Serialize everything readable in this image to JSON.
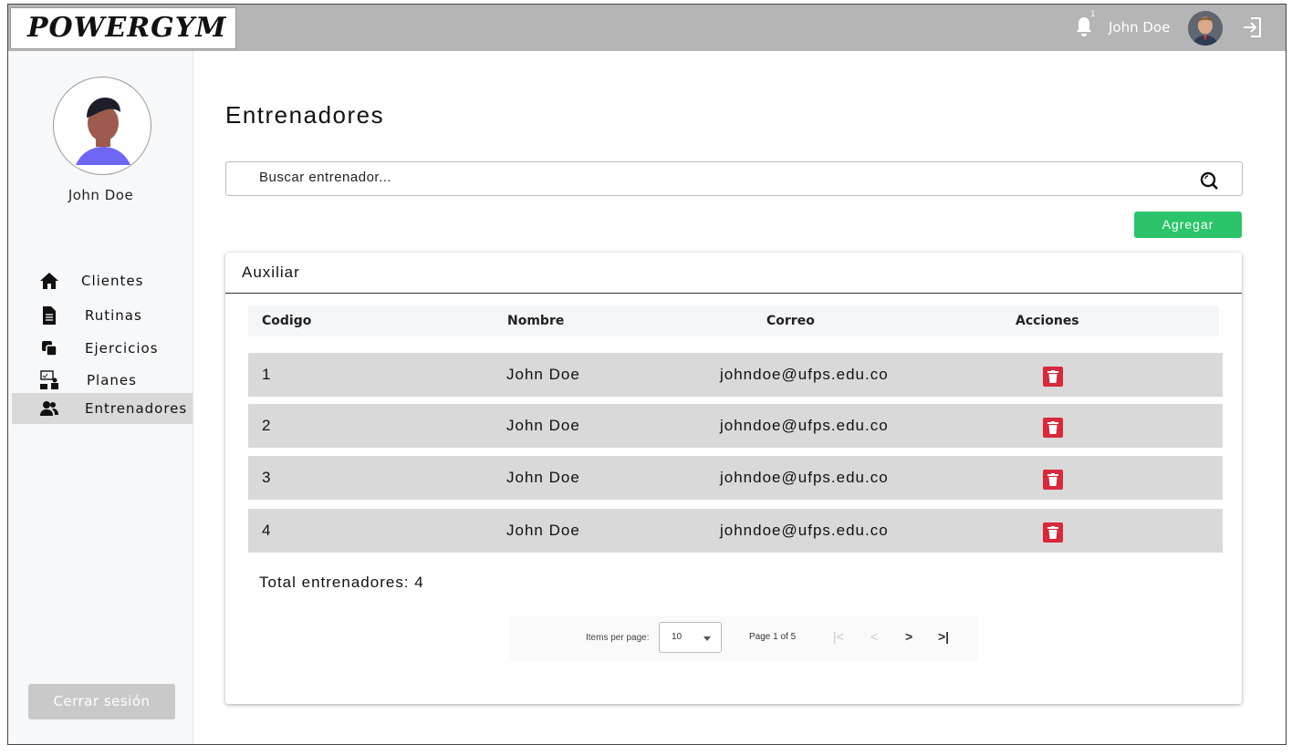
{
  "app": {
    "logo_text": "POWERGYM"
  },
  "topbar": {
    "notification_count": "1",
    "user_name": "John Doe"
  },
  "sidebar": {
    "user_name": "John Doe",
    "items": [
      {
        "label": "Clientes",
        "icon": "home-icon"
      },
      {
        "label": "Rutinas",
        "icon": "document-icon"
      },
      {
        "label": "Ejercicios",
        "icon": "copy-icon"
      },
      {
        "label": "Planes",
        "icon": "plans-icon"
      },
      {
        "label": "Entrenadores",
        "icon": "users-icon",
        "active": true
      }
    ],
    "logout_label": "Cerrar sesión"
  },
  "main": {
    "title": "Entrenadores",
    "search": {
      "placeholder": "Buscar entrenador..."
    },
    "add_label": "Agregar",
    "card_title": "Auxiliar",
    "columns": [
      "Codigo",
      "Nombre",
      "Correo",
      "Acciones"
    ],
    "rows": [
      {
        "codigo": "1",
        "nombre": "John Doe",
        "correo": "johndoe@ufps.edu.co"
      },
      {
        "codigo": "2",
        "nombre": "John Doe",
        "correo": "johndoe@ufps.edu.co"
      },
      {
        "codigo": "3",
        "nombre": "John Doe",
        "correo": "johndoe@ufps.edu.co"
      },
      {
        "codigo": "4",
        "nombre": "John Doe",
        "correo": "johndoe@ufps.edu.co"
      }
    ],
    "total_label": "Total entrenadores: 4",
    "paginator": {
      "items_per_page_label": "Items per page:",
      "items_per_page_value": "10",
      "range_label": "Page 1 of 5"
    }
  },
  "colors": {
    "topbar": "#b5b5b5",
    "add_button": "#2bc46a",
    "delete_button": "#d8283a",
    "row_bg": "#d9d9d9",
    "sidebar_avatar_shirt": "#7066f5"
  }
}
